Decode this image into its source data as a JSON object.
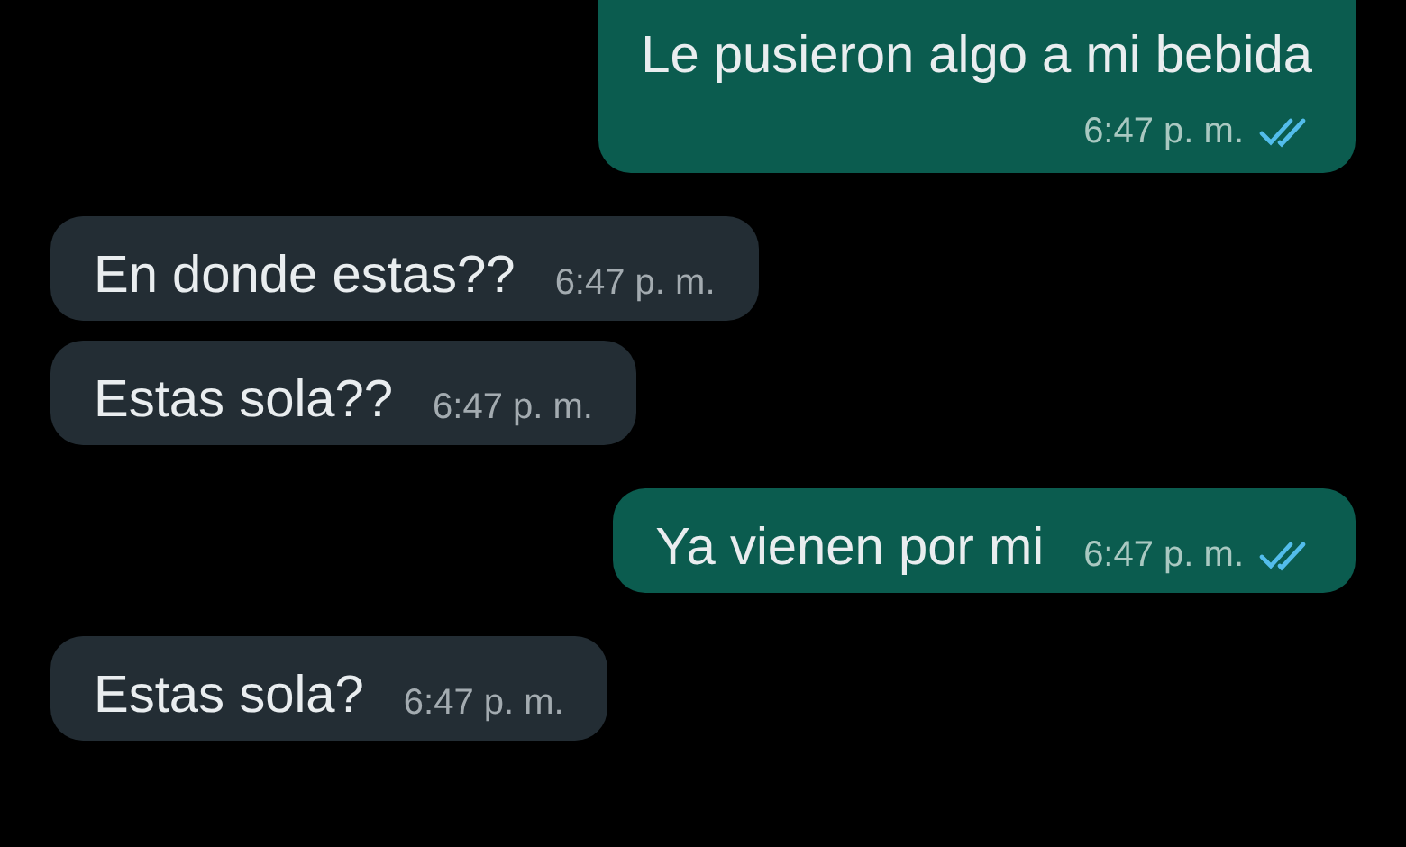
{
  "messages": [
    {
      "kind": "outgoing",
      "text": "Le pusieron algo a mi bebida",
      "time": "6:47 p. m.",
      "read": true,
      "time_below": true
    },
    {
      "kind": "incoming",
      "text": "En donde estas??",
      "time": "6:47 p. m."
    },
    {
      "kind": "incoming",
      "text": "Estas sola??",
      "time": "6:47 p. m."
    },
    {
      "kind": "outgoing",
      "text": "Ya vienen por mi",
      "time": "6:47 p. m.",
      "read": true
    },
    {
      "kind": "incoming",
      "text": "Estas sola?",
      "time": "6:47 p. m."
    }
  ]
}
